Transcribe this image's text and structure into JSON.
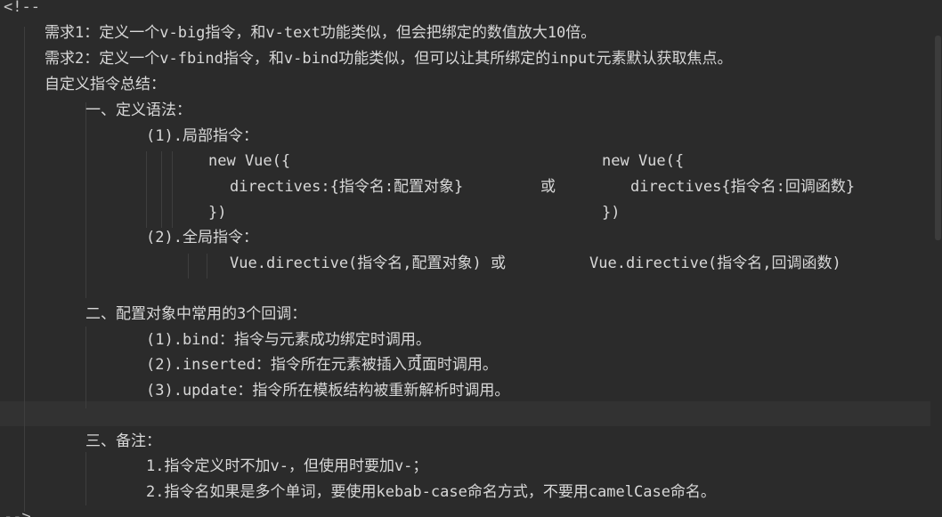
{
  "editor": {
    "lines": [
      {
        "text": "<!--"
      },
      {
        "text": "需求1：定义一个v-big指令，和v-text功能类似，但会把绑定的数值放大10倍。"
      },
      {
        "text": "需求2：定义一个v-fbind指令，和v-bind功能类似，但可以让其所绑定的input元素默认获取焦点。"
      },
      {
        "text": "自定义指令总结："
      },
      {
        "text": "一、定义语法："
      },
      {
        "text": "(1).局部指令："
      },
      {
        "text_left": "new Vue({",
        "text_right": "new Vue({"
      },
      {
        "text_left": "directives:{指令名:配置对象}",
        "text_mid": "或",
        "text_right": "directives{指令名:回调函数}"
      },
      {
        "text_left": "})",
        "text_right": "})"
      },
      {
        "text": "(2).全局指令："
      },
      {
        "text_left": "Vue.directive(指令名,配置对象) 或",
        "text_right": "Vue.directive(指令名,回调函数)"
      },
      {
        "text": ""
      },
      {
        "text": "二、配置对象中常用的3个回调："
      },
      {
        "text": "(1).bind：指令与元素成功绑定时调用。"
      },
      {
        "text": "(2).inserted：指令所在元素被插入页面时调用。"
      },
      {
        "text": "(3).update：指令所在模板结构被重新解析时调用。"
      },
      {
        "text": ""
      },
      {
        "text": "三、备注："
      },
      {
        "text": "1.指令定义时不加v-，但使用时要加v-；"
      },
      {
        "text": "2.指令名如果是多个单词，要使用kebab-case命名方式，不要用camelCase命名。"
      },
      {
        "text": "-->"
      }
    ]
  },
  "colors": {
    "background": "#2b2b2b",
    "text": "#d8d8d8",
    "guide": "#3e3e3e",
    "current_line": "#323232"
  },
  "icons": {
    "text_cursor": "i-beam-cursor-icon"
  }
}
